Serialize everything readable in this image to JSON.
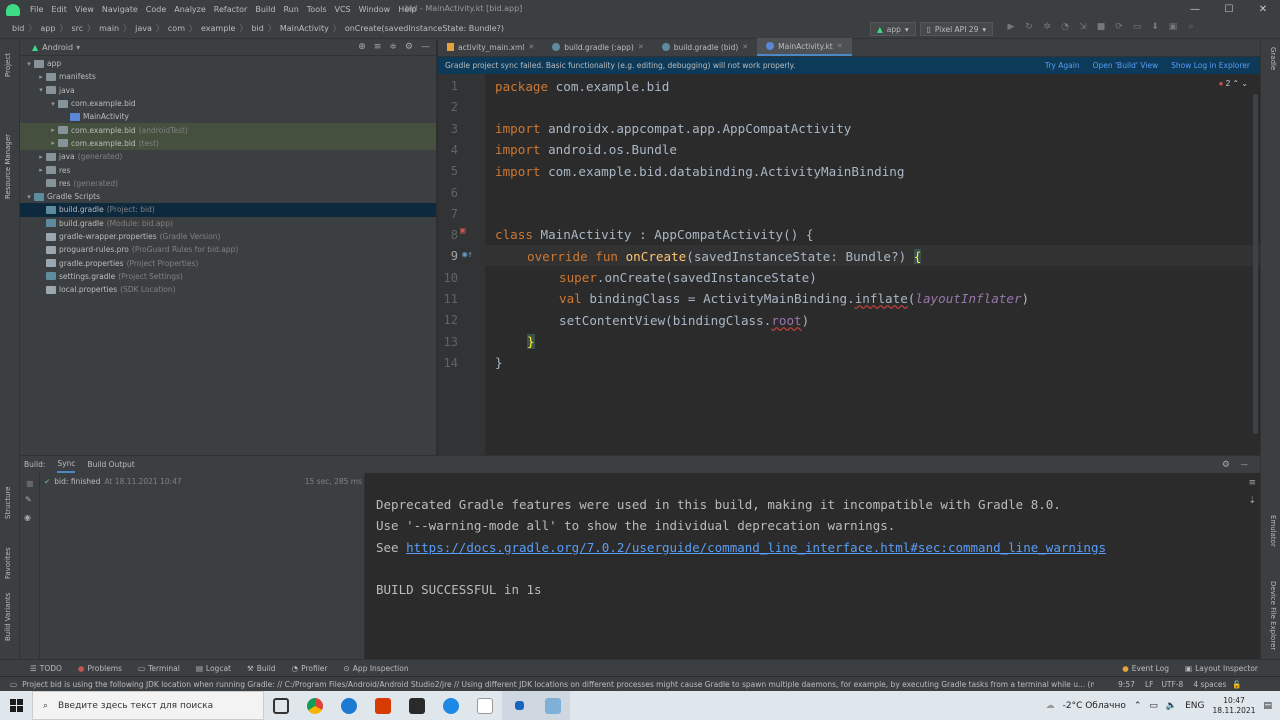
{
  "menu": {
    "items": [
      "File",
      "Edit",
      "View",
      "Navigate",
      "Code",
      "Analyze",
      "Refactor",
      "Build",
      "Run",
      "Tools",
      "VCS",
      "Window",
      "Help"
    ],
    "window_title": "bid - MainActivity.kt [bid.app]"
  },
  "breadcrumb": [
    "bid",
    "app",
    "src",
    "main",
    "java",
    "com",
    "example",
    "bid",
    "MainActivity",
    "onCreate(savedInstanceState: Bundle?)"
  ],
  "run_config": {
    "module": "app",
    "device": "Pixel API 29"
  },
  "project": {
    "view_mode": "Android",
    "tree": [
      {
        "label": "app",
        "hint": "",
        "level": 0,
        "arrow": "▾",
        "icon": "fold"
      },
      {
        "label": "manifests",
        "hint": "",
        "level": 1,
        "arrow": "▸",
        "icon": "fold"
      },
      {
        "label": "java",
        "hint": "",
        "level": 1,
        "arrow": "▾",
        "icon": "fold"
      },
      {
        "label": "com.example.bid",
        "hint": "",
        "level": 2,
        "arrow": "▾",
        "icon": "fold"
      },
      {
        "label": "MainActivity",
        "hint": "",
        "level": 3,
        "arrow": "",
        "icon": "kt"
      },
      {
        "label": "com.example.bid",
        "hint": "(androidTest)",
        "level": 2,
        "arrow": "▸",
        "icon": "fold",
        "hl": true
      },
      {
        "label": "com.example.bid",
        "hint": "(test)",
        "level": 2,
        "arrow": "▸",
        "icon": "fold",
        "hl": true
      },
      {
        "label": "java",
        "hint": "(generated)",
        "level": 1,
        "arrow": "▸",
        "icon": "fold"
      },
      {
        "label": "res",
        "hint": "",
        "level": 1,
        "arrow": "▸",
        "icon": "fold"
      },
      {
        "label": "res",
        "hint": "(generated)",
        "level": 1,
        "arrow": "",
        "icon": "fold"
      },
      {
        "label": "Gradle Scripts",
        "hint": "",
        "level": 0,
        "arrow": "▾",
        "icon": "gradle"
      },
      {
        "label": "build.gradle",
        "hint": "(Project: bid)",
        "level": 1,
        "arrow": "",
        "icon": "gradle",
        "selected": true
      },
      {
        "label": "build.gradle",
        "hint": "(Module: bid.app)",
        "level": 1,
        "arrow": "",
        "icon": "gradle"
      },
      {
        "label": "gradle-wrapper.properties",
        "hint": "(Gradle Version)",
        "level": 1,
        "arrow": "",
        "icon": "file"
      },
      {
        "label": "proguard-rules.pro",
        "hint": "(ProGuard Rules for bid.app)",
        "level": 1,
        "arrow": "",
        "icon": "file"
      },
      {
        "label": "gradle.properties",
        "hint": "(Project Properties)",
        "level": 1,
        "arrow": "",
        "icon": "file"
      },
      {
        "label": "settings.gradle",
        "hint": "(Project Settings)",
        "level": 1,
        "arrow": "",
        "icon": "gradle"
      },
      {
        "label": "local.properties",
        "hint": "(SDK Location)",
        "level": 1,
        "arrow": "",
        "icon": "file"
      }
    ]
  },
  "tabs": [
    {
      "label": "activity_main.xml",
      "active": false
    },
    {
      "label": "build.gradle (:app)",
      "active": false
    },
    {
      "label": "build.gradle (bid)",
      "active": false
    },
    {
      "label": "MainActivity.kt",
      "active": true
    }
  ],
  "sync_banner": {
    "message": "Gradle project sync failed. Basic functionality (e.g. editing, debugging) will not work properly.",
    "links": [
      "Try Again",
      "Open 'Build' View",
      "Show Log in Explorer"
    ]
  },
  "editor": {
    "error_count": "2",
    "current_line": 9,
    "line_numbers": [
      "1",
      "2",
      "3",
      "4",
      "5",
      "6",
      "7",
      "8",
      "9",
      "10",
      "11",
      "12",
      "13",
      "14"
    ],
    "code": {
      "l1": {
        "kw": "package",
        "rest": " com.example.bid"
      },
      "l3": {
        "kw": "import",
        "rest": " androidx.appcompat.app.AppCompatActivity"
      },
      "l4": {
        "kw": "import",
        "rest": " android.os.Bundle"
      },
      "l5": {
        "kw": "import",
        "rest": " com.example.bid.databinding.ActivityMainBinding"
      },
      "l8": {
        "kw": "class",
        "rest": " MainActivity : AppCompatActivity() {"
      },
      "l9": {
        "kw": "override fun",
        "fn": "onCreate",
        "rest": "(savedInstanceState: Bundle?) ",
        "brace": "{"
      },
      "l10": {
        "kw": "super",
        "rest": ".onCreate(savedInstanceState)"
      },
      "l11": {
        "kw": "val",
        "rest": " bindingClass = ActivityMainBinding.",
        "fn": "inflate",
        "paren_open": "(",
        "it": "layoutInflater",
        "paren_close": ")"
      },
      "l12": {
        "rest": "setContentView(bindingClass.",
        "field": "root",
        "close": ")"
      },
      "l13": {
        "brace": "}"
      },
      "l14": {
        "rest": "}"
      }
    }
  },
  "build": {
    "label": "Build:",
    "tabs": [
      "Sync",
      "Build Output"
    ],
    "tree_item": {
      "name": "bid:",
      "status": "finished",
      "time": "At 18.11.2021 10:47",
      "duration": "15 sec, 285 ms"
    },
    "output": [
      "Deprecated Gradle features were used in this build, making it incompatible with Gradle 8.0.",
      "Use '--warning-mode all' to show the individual deprecation warnings.",
      "See ",
      "BUILD SUCCESSFUL in 1s"
    ],
    "link": "https://docs.gradle.org/7.0.2/userguide/command_line_interface.html#sec:command_line_warnings"
  },
  "left_strip": [
    "Project",
    "Resource Manager",
    "Structure",
    "Favorites",
    "Build Variants"
  ],
  "right_strip": [
    "Gradle",
    "Emulator",
    "Device File Explorer"
  ],
  "tool_windows": [
    "TODO",
    "Problems",
    "Terminal",
    "Logcat",
    "Build",
    "Profiler",
    "App Inspection"
  ],
  "tool_windows_right": [
    "Event Log",
    "Layout Inspector"
  ],
  "status": {
    "message": "Project bid is using the following JDK location when running Gradle: // C:/Program Files/Android/Android Studio2/jre // Using different JDK locations on different processes might cause Gradle to spawn multiple daemons, for example, by executing Gradle tasks from a terminal while u... (moments ago)",
    "position": "9:57",
    "line_sep": "LF",
    "encoding": "UTF-8",
    "indent": "4 spaces"
  },
  "taskbar": {
    "search_placeholder": "Введите здесь текст для поиска",
    "weather": "-2°C  Облачно",
    "lang": "ENG",
    "time": "10:47",
    "date": "18.11.2021"
  },
  "colors": {
    "accent": "#4a88c7",
    "keyword": "#cc7832",
    "function": "#ffc66d",
    "banner": "#0d3a58"
  }
}
